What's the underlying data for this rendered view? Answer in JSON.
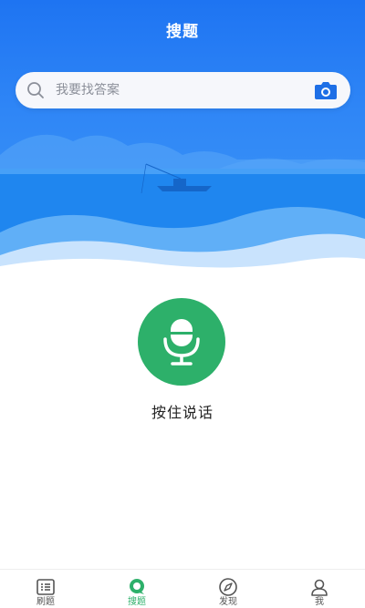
{
  "header": {
    "title": "搜题"
  },
  "search": {
    "placeholder": "我要找答案"
  },
  "voice": {
    "hint": "按住说话"
  },
  "tabbar": {
    "active_index": 1,
    "items": [
      {
        "label": "刷题",
        "icon": "list-icon"
      },
      {
        "label": "搜题",
        "icon": "search-bubble-icon"
      },
      {
        "label": "发现",
        "icon": "compass-icon"
      },
      {
        "label": "我",
        "icon": "user-icon"
      }
    ]
  },
  "colors": {
    "accent_green": "#2db06a",
    "hero_blue": "#1e74f2",
    "camera_blue": "#1e6fe6"
  }
}
